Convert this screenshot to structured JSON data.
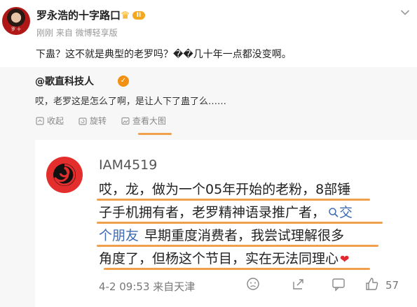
{
  "post": {
    "author": "罗永浩的十字路口",
    "level_badge": "II",
    "meta": "刚刚 来自 微博轻享版",
    "content": "下蛊？这不就是典型的老罗吗？��几十年一点都没变啊。"
  },
  "repost": {
    "author": "@歌直科技人",
    "text": "哎，老罗这是怎么了啊，是让人下了蛊了么……",
    "actions": {
      "favorite": "收起",
      "rotate": "旋转",
      "view_large": "查看大图"
    }
  },
  "screenshot": {
    "name": "IAM4519",
    "line1": "哎，龙，做为一个05年开始的老粉，8部锤",
    "line2a": "子手机拥有者，老罗精神语录推广者，",
    "line2_link": "交",
    "line3_link": "个朋友",
    "line3b": "早期重度消费者，我尝试理解很多",
    "line4": "角度了，但杨这个节目，实在无法同理心",
    "footer": "4-2 09:53 来自天津",
    "like_count": "57"
  },
  "colors": {
    "highlight": "#f0a04b",
    "vip_orange": "#f3a81f",
    "link_blue": "#3d6ab0"
  }
}
